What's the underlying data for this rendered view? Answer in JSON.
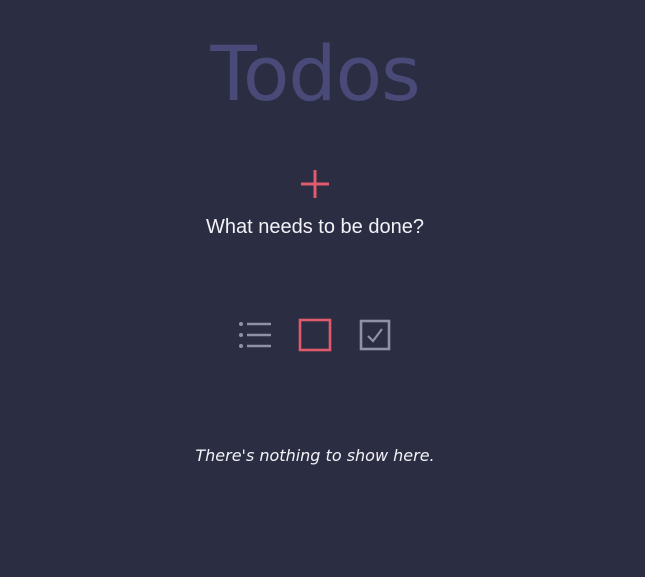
{
  "header": {
    "title": "Todos"
  },
  "new_todo": {
    "placeholder": "What needs to be done?",
    "value": ""
  },
  "filters": [
    {
      "icon": "list-icon",
      "selected": false
    },
    {
      "icon": "empty-checkbox-icon",
      "selected": true
    },
    {
      "icon": "checked-checkbox-icon",
      "selected": false
    }
  ],
  "empty_state": {
    "message": "There's nothing to show here."
  },
  "colors": {
    "background": "#2b2d42",
    "title": "#4a4a78",
    "accent": "#e05a6d",
    "icon_muted": "#8d92a8",
    "text": "#f2f2f7"
  }
}
